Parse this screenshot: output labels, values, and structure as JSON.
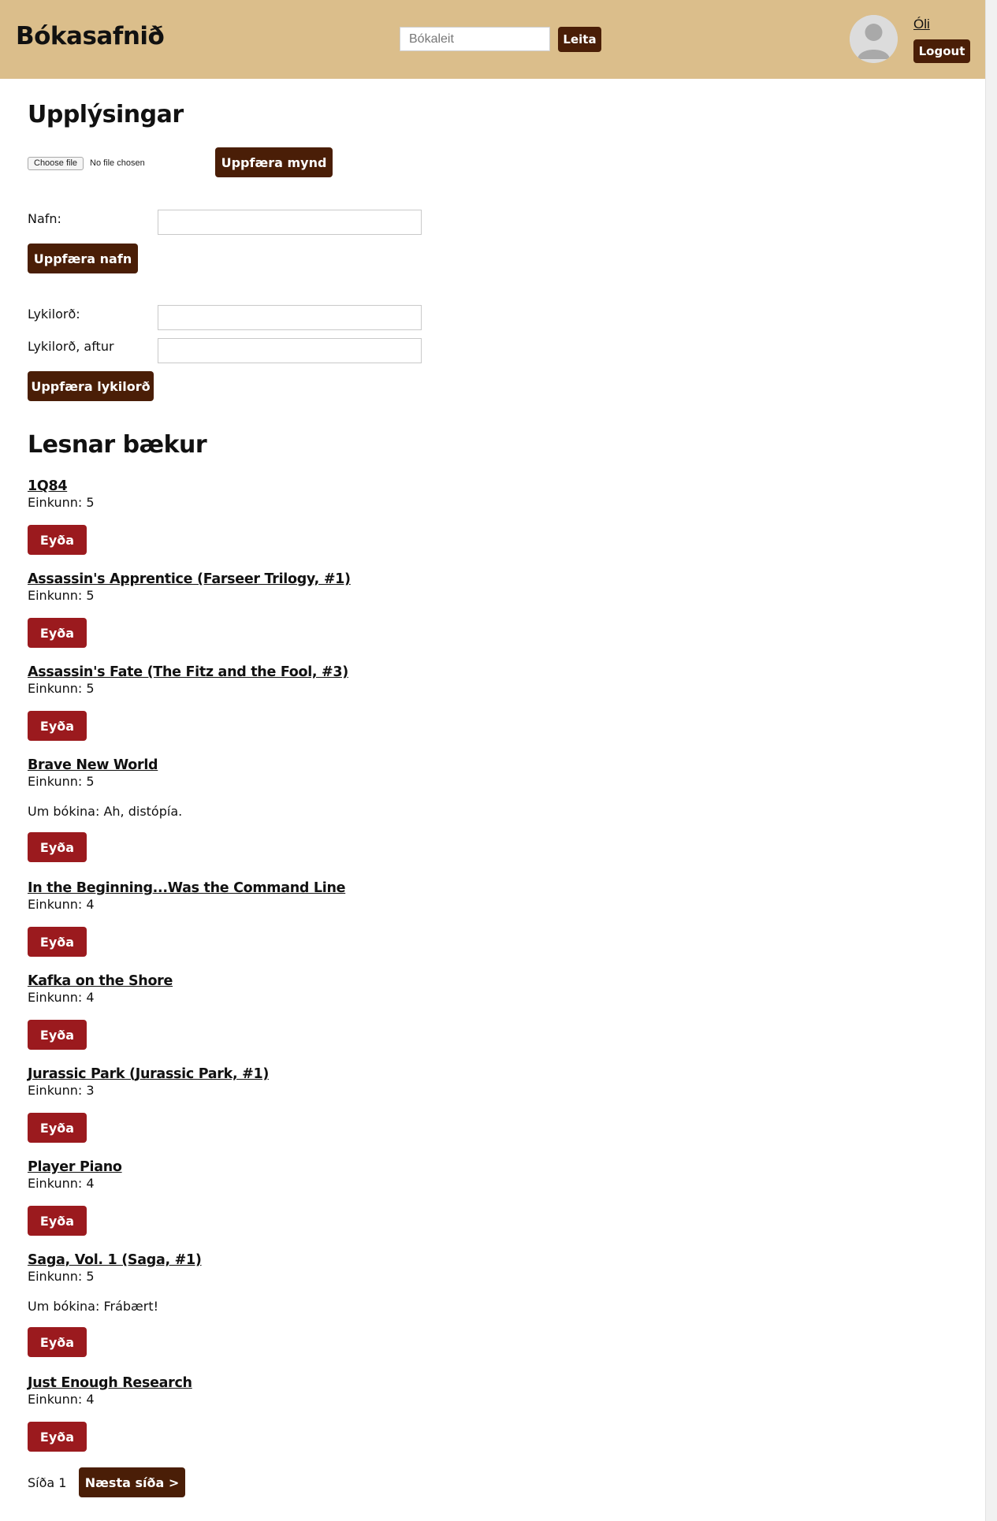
{
  "header": {
    "brand": "Bókasafnið",
    "search": {
      "placeholder": "Bókaleit",
      "value": ""
    },
    "search_button": "Leita",
    "user_name": "Óli",
    "logout_button": "Logout"
  },
  "info": {
    "title": "Upplýsingar",
    "file_choose_button": "Choose file",
    "file_status": "No file chosen",
    "update_image_button": "Uppfæra mynd",
    "name_label": "Nafn:",
    "name_value": "",
    "update_name_button": "Uppfæra nafn",
    "password_label": "Lykilorð:",
    "password_again_label": "Lykilorð, aftur",
    "update_password_button": "Uppfæra lykilorð"
  },
  "read_books": {
    "title": "Lesnar bækur",
    "rating_prefix": "Einkunn:",
    "review_prefix": "Um bókina:",
    "delete_label": "Eyða",
    "books": [
      {
        "title": "1Q84",
        "rating": "Einkunn: 5"
      },
      {
        "title": "Assassin's Apprentice (Farseer Trilogy, #1)",
        "rating": "Einkunn: 5"
      },
      {
        "title": "Assassin's Fate (The Fitz and the Fool, #3)",
        "rating": "Einkunn: 5"
      },
      {
        "title": "Brave New World",
        "rating": "Einkunn: 5",
        "review": "Um bókina: Ah, distópía."
      },
      {
        "title": "In the Beginning...Was the Command Line",
        "rating": "Einkunn: 4"
      },
      {
        "title": "Kafka on the Shore",
        "rating": "Einkunn: 4"
      },
      {
        "title": "Jurassic Park (Jurassic Park, #1)",
        "rating": "Einkunn: 3"
      },
      {
        "title": "Player Piano",
        "rating": "Einkunn: 4"
      },
      {
        "title": "Saga, Vol. 1 (Saga, #1)",
        "rating": "Einkunn: 5",
        "review": "Um bókina: Frábært!"
      },
      {
        "title": "Just Enough Research",
        "rating": "Einkunn: 4"
      }
    ]
  },
  "pagination": {
    "page_label": "Síða 1",
    "next_button": "Næsta síða >"
  },
  "colors": {
    "header_bg": "#dbbe8b",
    "primary_button": "#4a1e07",
    "danger_button": "#9b1a1e"
  },
  "icons": {
    "avatar": "user-avatar-icon"
  }
}
